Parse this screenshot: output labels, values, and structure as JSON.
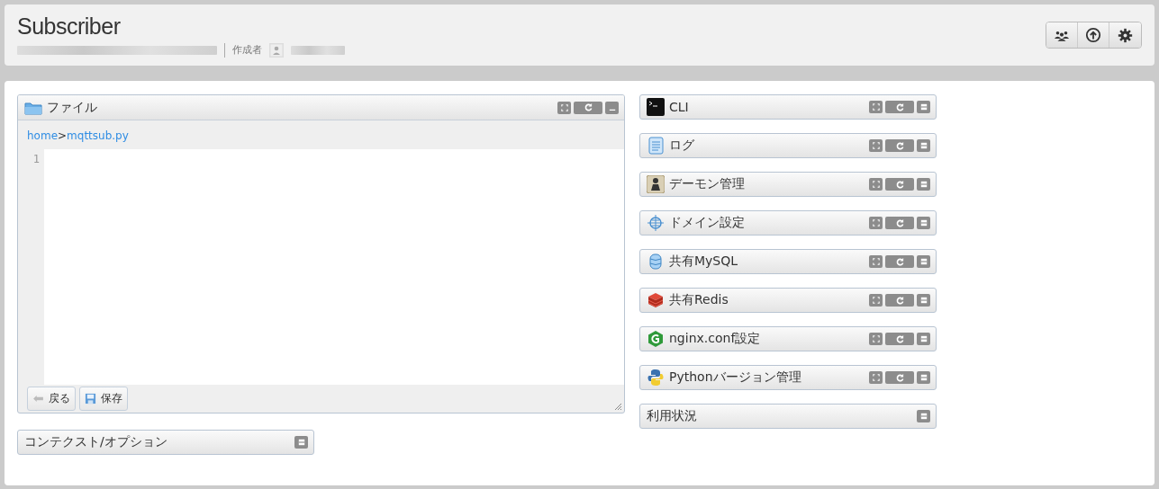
{
  "header": {
    "title": "Subscriber",
    "author_label": "作成者"
  },
  "header_actions": [
    {
      "kind": "users"
    },
    {
      "kind": "upload"
    },
    {
      "kind": "settings"
    }
  ],
  "file_panel": {
    "kind": "folder",
    "title": "ファイル",
    "controls": [
      {
        "kind": "expand"
      },
      {
        "kind": "reload"
      },
      {
        "kind": "minimize"
      }
    ],
    "breadcrumb": [
      {
        "kind": "link",
        "text": "home"
      },
      {
        "kind": "sep",
        "text": ">"
      },
      {
        "kind": "link",
        "text": "mqttsub.py"
      }
    ],
    "line_numbers": [
      "1"
    ],
    "buttons": [
      {
        "kind": "back",
        "label": "戻る"
      },
      {
        "kind": "save",
        "label": "保存"
      }
    ]
  },
  "context_panel": {
    "title": "コンテクスト/オプション",
    "controls": [
      {
        "kind": "collapse"
      }
    ]
  },
  "panels": [
    {
      "kind": "terminal",
      "title": "CLI",
      "controls": [
        {
          "kind": "expand"
        },
        {
          "kind": "reload"
        },
        {
          "kind": "collapse"
        }
      ]
    },
    {
      "kind": "log",
      "title": "ログ",
      "controls": [
        {
          "kind": "expand"
        },
        {
          "kind": "reload"
        },
        {
          "kind": "collapse"
        }
      ]
    },
    {
      "kind": "daemon",
      "title": "デーモン管理",
      "controls": [
        {
          "kind": "expand"
        },
        {
          "kind": "reload"
        },
        {
          "kind": "collapse"
        }
      ]
    },
    {
      "kind": "domain",
      "title": "ドメイン設定",
      "controls": [
        {
          "kind": "expand"
        },
        {
          "kind": "reload"
        },
        {
          "kind": "collapse"
        }
      ]
    },
    {
      "kind": "database",
      "title": "共有MySQL",
      "controls": [
        {
          "kind": "expand"
        },
        {
          "kind": "reload"
        },
        {
          "kind": "collapse"
        }
      ]
    },
    {
      "kind": "redis",
      "title": "共有Redis",
      "controls": [
        {
          "kind": "expand"
        },
        {
          "kind": "reload"
        },
        {
          "kind": "collapse"
        }
      ]
    },
    {
      "kind": "nginx",
      "title": "nginx.conf設定",
      "controls": [
        {
          "kind": "expand"
        },
        {
          "kind": "reload"
        },
        {
          "kind": "collapse"
        }
      ]
    },
    {
      "kind": "python",
      "title": "Pythonバージョン管理",
      "controls": [
        {
          "kind": "expand"
        },
        {
          "kind": "reload"
        },
        {
          "kind": "collapse"
        }
      ]
    },
    {
      "kind": "plain",
      "title": "利用状況",
      "controls": [
        {
          "kind": "collapse"
        }
      ]
    }
  ]
}
